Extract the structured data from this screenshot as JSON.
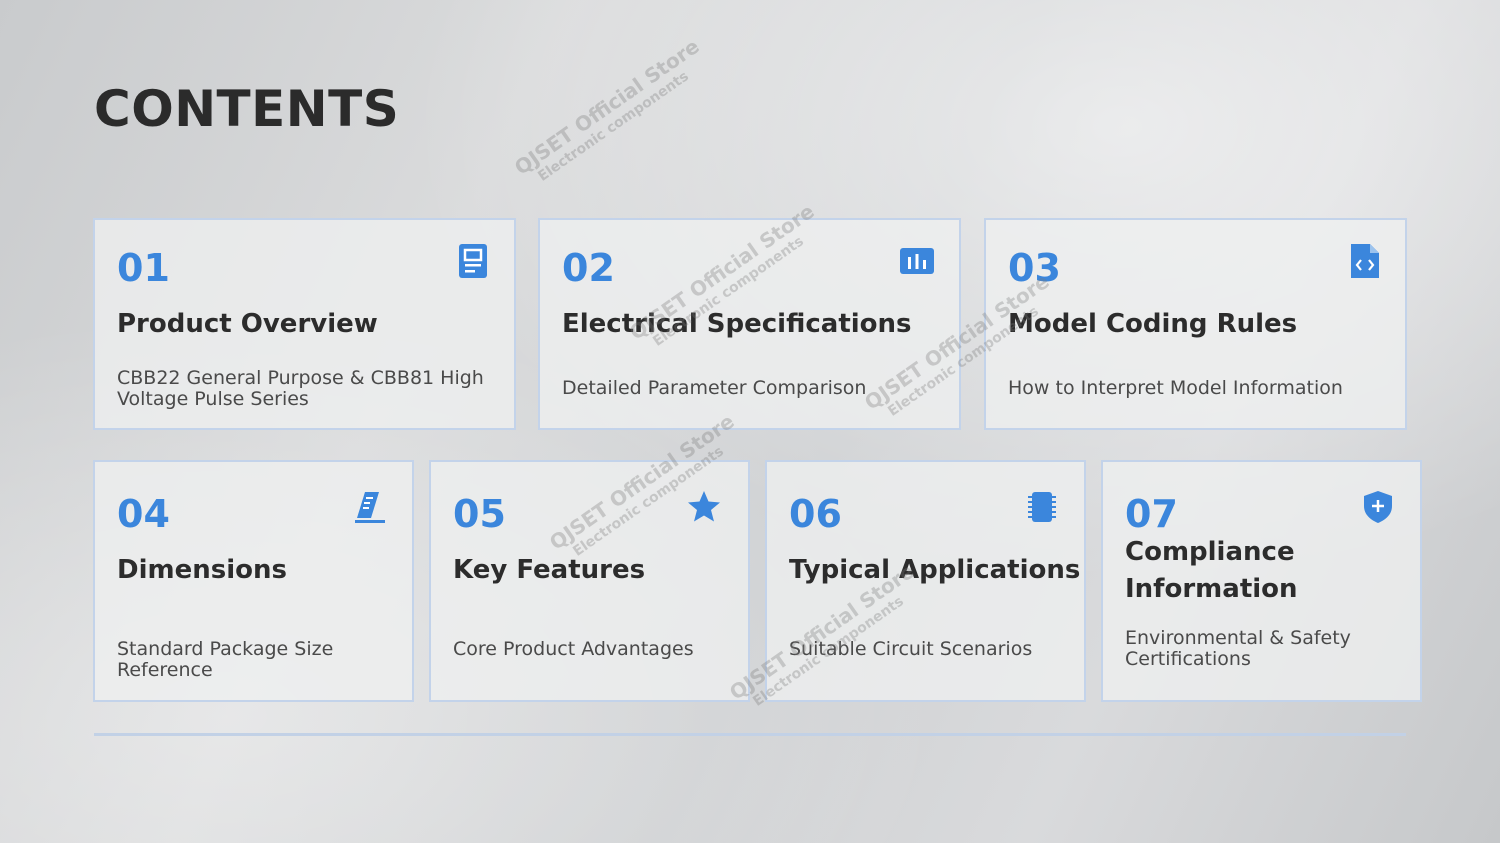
{
  "title": "CONTENTS",
  "cards": [
    {
      "number": "01",
      "heading": "Product Overview",
      "description": "CBB22 General Purpose & CBB81 High Voltage Pulse Series",
      "icon": "document-icon"
    },
    {
      "number": "02",
      "heading": "Electrical Specifications",
      "description": "Detailed Parameter Comparison",
      "icon": "bar-chart-icon"
    },
    {
      "number": "03",
      "heading": "Model Coding Rules",
      "description": "How to Interpret Model Information",
      "icon": "code-file-icon"
    },
    {
      "number": "04",
      "heading": "Dimensions",
      "description": "Standard Package Size Reference",
      "icon": "ruler-icon"
    },
    {
      "number": "05",
      "heading": "Key Features",
      "description": "Core Product Advantages",
      "icon": "star-icon"
    },
    {
      "number": "06",
      "heading": "Typical Applications",
      "description": "Suitable Circuit Scenarios",
      "icon": "chip-icon"
    },
    {
      "number": "07",
      "heading": "Compliance Information",
      "description": "Environmental & Safety Certifications",
      "icon": "shield-plus-icon"
    }
  ],
  "watermark": {
    "line1": "QJSET Official Store",
    "line2": "Electronic components"
  },
  "colors": {
    "accent": "#3b86dc",
    "card_border": "#c3d3ea",
    "heading": "#2c2c2c"
  }
}
